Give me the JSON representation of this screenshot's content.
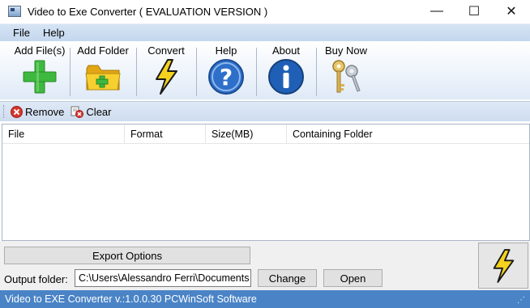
{
  "window": {
    "title": "Video to Exe Converter ( EVALUATION VERSION )",
    "minimize_glyph": "—",
    "maximize_glyph": "☐",
    "close_glyph": "✕"
  },
  "menu": {
    "items": [
      {
        "label": "File"
      },
      {
        "label": "Help"
      }
    ]
  },
  "toolbar": {
    "buttons": [
      {
        "label": "Add File(s)",
        "icon": "green-plus-icon"
      },
      {
        "label": "Add Folder",
        "icon": "folder-add-icon"
      },
      {
        "label": "Convert",
        "icon": "lightning-icon"
      },
      {
        "label": "Help",
        "icon": "help-icon"
      },
      {
        "label": "About",
        "icon": "info-icon"
      },
      {
        "label": "Buy Now",
        "icon": "keys-icon"
      }
    ]
  },
  "toolbar2": {
    "remove_label": "Remove",
    "clear_label": "Clear"
  },
  "list": {
    "columns": [
      "File",
      "Format",
      "Size(MB)",
      "Containing Folder"
    ],
    "rows": []
  },
  "bottom": {
    "export_label": "Export Options",
    "output_label": "Output folder:",
    "output_value": "C:\\Users\\Alessandro Ferri\\Documents",
    "change_label": "Change",
    "open_label": "Open"
  },
  "status": {
    "text": "Video to EXE Converter v.:1.0.0.30 PCWinSoft Software"
  },
  "colors": {
    "menubar": "#c9daef",
    "statusbar": "#4a84c6",
    "accent_yellow": "#f5d21e"
  }
}
